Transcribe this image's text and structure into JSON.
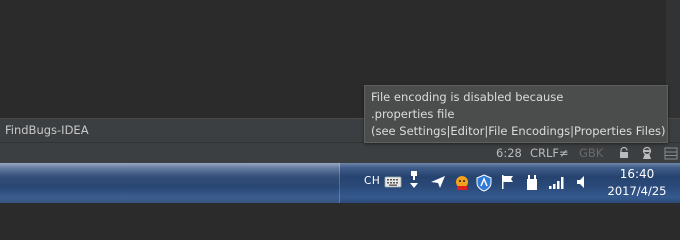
{
  "tool_window_bar": {
    "findbugs_tab_label": "FindBugs-IDEA"
  },
  "status_bar": {
    "caret_position": "6:28",
    "line_separator": "CRLF≠",
    "encoding": "GBK",
    "encoding_color": "#6a6a6a"
  },
  "tooltip": {
    "lines": [
      "File encoding is disabled because",
      ".properties file",
      "(see Settings|Editor|File Encodings|Properties Files)"
    ]
  },
  "taskbar": {
    "language_indicator": "CH",
    "clock_time": "16:40",
    "clock_date": "2017/4/25",
    "tray_icons": [
      "keyboard-icon",
      "network-usb-icon",
      "send-icon",
      "chat-app-icon",
      "shield-icon",
      "flag-icon",
      "device-icon",
      "signal-icon",
      "volume-icon"
    ]
  }
}
